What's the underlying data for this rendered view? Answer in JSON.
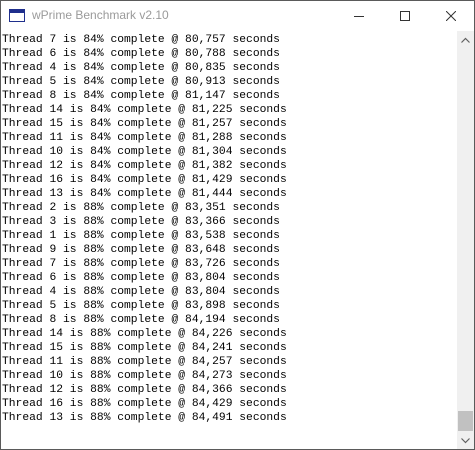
{
  "window": {
    "title": "wPrime Benchmark v2.10"
  },
  "icons": {
    "app": "console-window-icon",
    "minimize": "minimize-icon",
    "maximize": "maximize-icon",
    "close": "close-icon",
    "scroll_up": "chevron-up-icon",
    "scroll_down": "chevron-down-icon"
  },
  "colors": {
    "title_text": "#9a9a9a",
    "console_bg": "#ffffff",
    "console_text": "#000000",
    "scrollbar_track": "#f0f0f0",
    "scrollbar_thumb": "#c1c1c1"
  },
  "console": {
    "lines": [
      "Thread 7 is 84% complete @ 80,757 seconds",
      "Thread 6 is 84% complete @ 80,788 seconds",
      "Thread 4 is 84% complete @ 80,835 seconds",
      "Thread 5 is 84% complete @ 80,913 seconds",
      "Thread 8 is 84% complete @ 81,147 seconds",
      "Thread 14 is 84% complete @ 81,225 seconds",
      "Thread 15 is 84% complete @ 81,257 seconds",
      "Thread 11 is 84% complete @ 81,288 seconds",
      "Thread 10 is 84% complete @ 81,304 seconds",
      "Thread 12 is 84% complete @ 81,382 seconds",
      "Thread 16 is 84% complete @ 81,429 seconds",
      "Thread 13 is 84% complete @ 81,444 seconds",
      "Thread 2 is 88% complete @ 83,351 seconds",
      "Thread 3 is 88% complete @ 83,366 seconds",
      "Thread 1 is 88% complete @ 83,538 seconds",
      "Thread 9 is 88% complete @ 83,648 seconds",
      "Thread 7 is 88% complete @ 83,726 seconds",
      "Thread 6 is 88% complete @ 83,804 seconds",
      "Thread 4 is 88% complete @ 83,804 seconds",
      "Thread 5 is 88% complete @ 83,898 seconds",
      "Thread 8 is 88% complete @ 84,194 seconds",
      "Thread 14 is 88% complete @ 84,226 seconds",
      "Thread 15 is 88% complete @ 84,241 seconds",
      "Thread 11 is 88% complete @ 84,257 seconds",
      "Thread 10 is 88% complete @ 84,273 seconds",
      "Thread 12 is 88% complete @ 84,366 seconds",
      "Thread 16 is 88% complete @ 84,429 seconds",
      "Thread 13 is 88% complete @ 84,491 seconds"
    ]
  }
}
